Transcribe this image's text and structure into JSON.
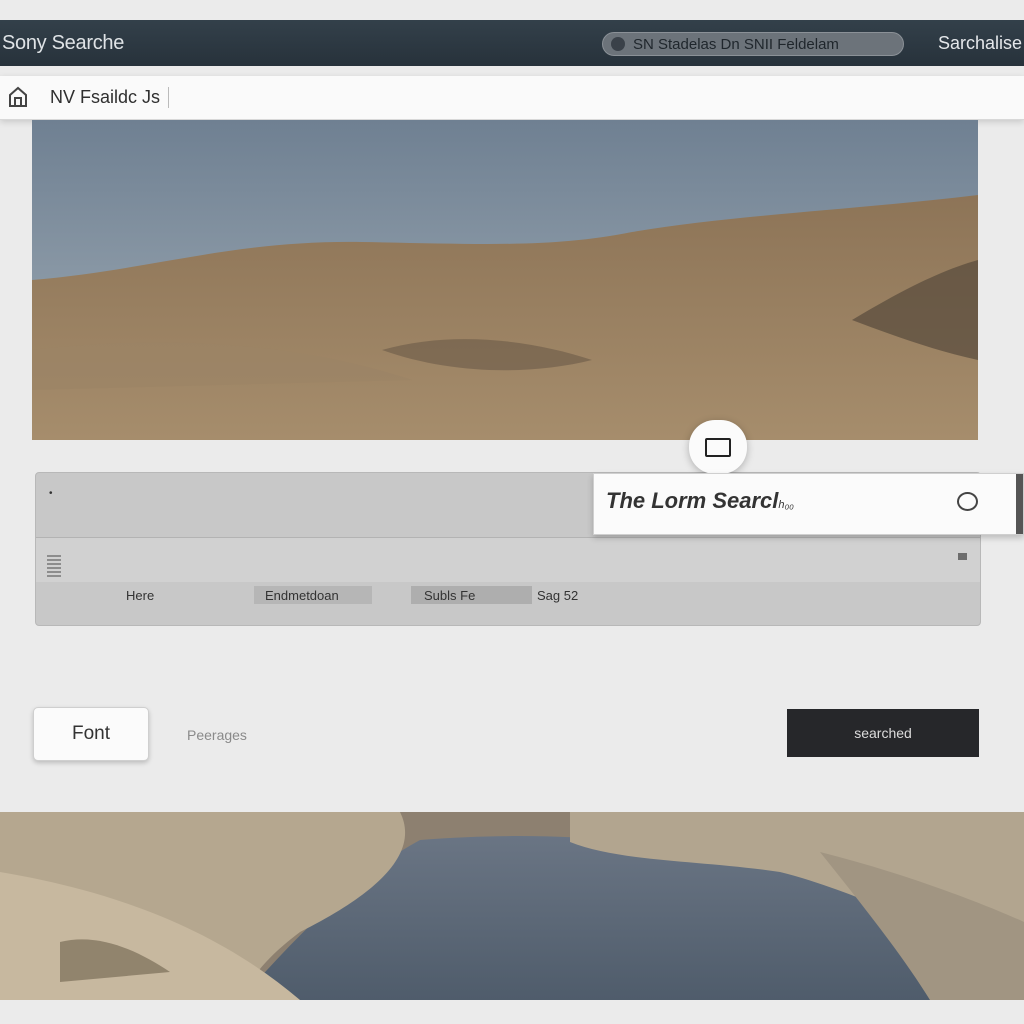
{
  "topbar": {
    "brand": "Sony Searche",
    "center_search": "SN Stadelas Dn SNII Feldelam",
    "right_label": "Sarchalise"
  },
  "subbar": {
    "home_icon": "home-icon",
    "title": "NV Fsaildc Js"
  },
  "hero": {
    "image": "desert-hills-landscape"
  },
  "float_control": {
    "icon": "rectangle-icon"
  },
  "search": {
    "text": "The Lorm Searcl",
    "suffix": "h₀₀",
    "icon": "circle-icon"
  },
  "panel": {
    "mark": "•",
    "cells": [
      "Here",
      "Endmetdoan",
      "Subls Fe",
      "Sag 52"
    ]
  },
  "actions": {
    "font_button": "Font",
    "pages_label": "Peerages",
    "dark_button": "searched"
  },
  "lower": {
    "image": "lake-canyon-landscape"
  },
  "colors": {
    "topbar": "#2b3640",
    "dark_button": "#26272a",
    "background": "#ebebeb"
  }
}
